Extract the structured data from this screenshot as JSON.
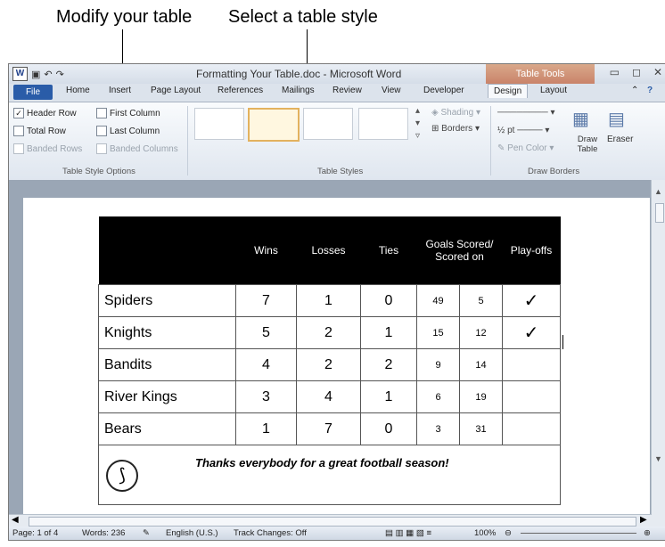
{
  "callouts": {
    "modify": "Modify your table",
    "select": "Select a table style"
  },
  "window": {
    "title": "Formatting Your Table.doc  -  Microsoft Word",
    "word_icon": "W",
    "contextual_tab_group": "Table Tools",
    "controls": {
      "minimize": "▭",
      "maximize": "◻",
      "close": "✕"
    }
  },
  "tabs": [
    "File",
    "Home",
    "Insert",
    "Page Layout",
    "References",
    "Mailings",
    "Review",
    "View",
    "Developer",
    "Design",
    "Layout"
  ],
  "ribbon": {
    "options": {
      "header_row": "Header Row",
      "first_column": "First Column",
      "total_row": "Total Row",
      "last_column": "Last Column",
      "banded_rows": "Banded Rows",
      "banded_columns": "Banded Columns",
      "header_row_checked": "✓"
    },
    "group_style_options": "Table Style Options",
    "group_table_styles": "Table Styles",
    "shading": "Shading",
    "borders": "Borders",
    "pen_weight": "½ pt",
    "pen_color": "Pen Color",
    "draw_table": "Draw Table",
    "eraser": "Eraser",
    "group_draw_borders": "Draw Borders"
  },
  "table": {
    "headers": [
      "",
      "Wins",
      "Losses",
      "Ties",
      "Goals Scored/ Scored on",
      "Play-offs"
    ],
    "rows": [
      {
        "team": "Spiders",
        "wins": "7",
        "losses": "1",
        "ties": "0",
        "g1": "49",
        "g2": "5",
        "playoff": "✓"
      },
      {
        "team": "Knights",
        "wins": "5",
        "losses": "2",
        "ties": "1",
        "g1": "15",
        "g2": "12",
        "playoff": "✓"
      },
      {
        "team": "Bandits",
        "wins": "4",
        "losses": "2",
        "ties": "2",
        "g1": "9",
        "g2": "14",
        "playoff": ""
      },
      {
        "team": "River Kings",
        "wins": "3",
        "losses": "4",
        "ties": "1",
        "g1": "6",
        "g2": "19",
        "playoff": ""
      },
      {
        "team": "Bears",
        "wins": "1",
        "losses": "7",
        "ties": "0",
        "g1": "3",
        "g2": "31",
        "playoff": ""
      }
    ],
    "footer_text": "Thanks everybody for a great football season!",
    "logo_glyph": "⟆"
  },
  "status": {
    "page": "Page: 1 of 4",
    "words": "Words: 236",
    "language": "English (U.S.)",
    "track_changes": "Track Changes: Off",
    "zoom": "100%"
  }
}
